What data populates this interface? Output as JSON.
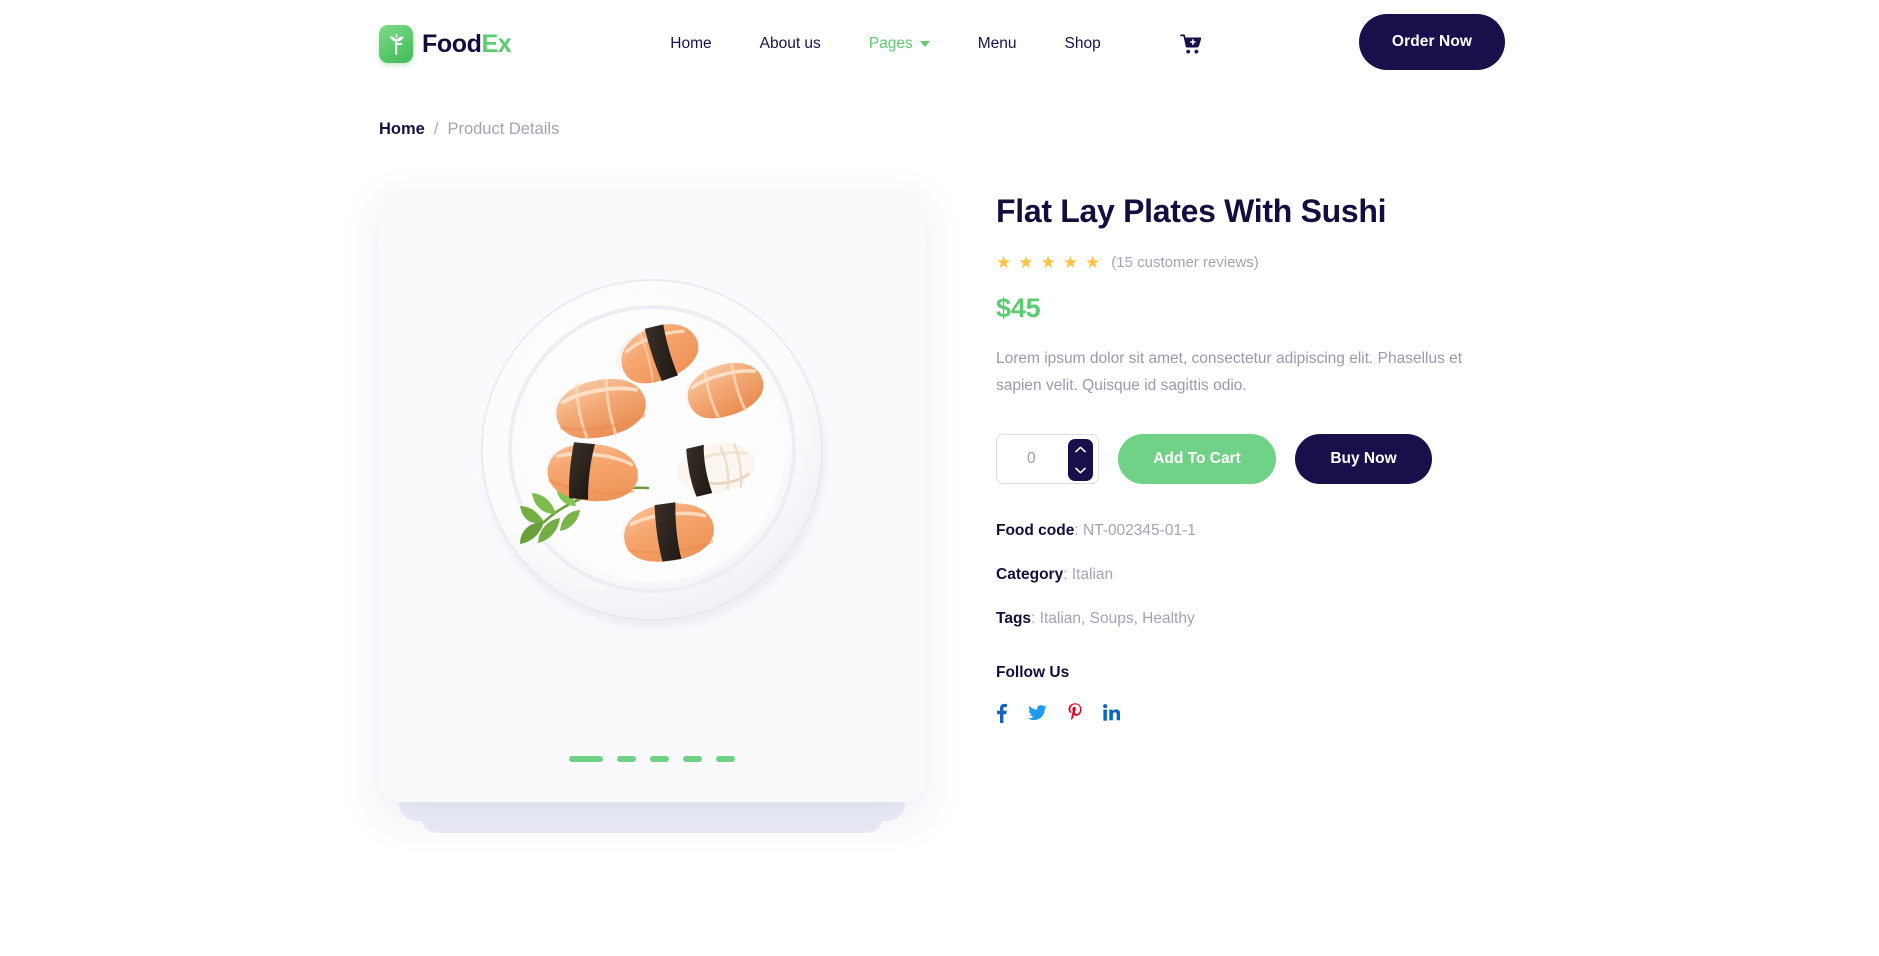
{
  "header": {
    "brand": {
      "name_dark": "Food",
      "name_accent": "Ex",
      "icon": "leaf-sprout-icon"
    },
    "nav": [
      {
        "label": "Home",
        "active": false,
        "caret": false
      },
      {
        "label": "About us",
        "active": false,
        "caret": false
      },
      {
        "label": "Pages",
        "active": true,
        "caret": true
      },
      {
        "label": "Menu",
        "active": false,
        "caret": false
      },
      {
        "label": "Shop",
        "active": false,
        "caret": false
      }
    ],
    "cart_icon": "shopping-cart-add-icon",
    "order_button": "Order Now"
  },
  "breadcrumb": {
    "home": "Home",
    "separator": "/",
    "current": "Product Details"
  },
  "gallery": {
    "alt": "Flat lay white plate with six pieces of salmon sushi and parsley garnish",
    "dots": [
      {
        "active": true
      },
      {
        "active": false
      },
      {
        "active": false
      },
      {
        "active": false
      },
      {
        "active": false
      }
    ]
  },
  "product": {
    "title": "Flat Lay Plates With Sushi",
    "stars": 5,
    "star_glyph": "★",
    "review_count": "(15 customer reviews)",
    "price": "$45",
    "description": "Lorem ipsum dolor sit amet, consectetur adipiscing elit. Phasellus et sapien velit. Quisque id sagittis odio.",
    "quantity_value": "0",
    "quantity_placeholder": "0",
    "add_to_cart_label": "Add To Cart",
    "buy_now_label": "Buy Now",
    "meta": [
      {
        "label": "Food code",
        "value": ": NT-002345-01-1"
      },
      {
        "label": "Category",
        "value": ": Italian"
      },
      {
        "label": "Tags",
        "value": ": Italian, Soups, Healthy"
      }
    ],
    "follow_title": "Follow Us",
    "socials": [
      {
        "name": "facebook-icon",
        "color": "#1764c0"
      },
      {
        "name": "twitter-icon",
        "color": "#1d9bf0"
      },
      {
        "name": "pinterest-icon",
        "color": "#e60023"
      },
      {
        "name": "linkedin-icon",
        "color": "#0a66c2"
      }
    ]
  },
  "colors": {
    "brand_green": "#5ccb72",
    "navy": "#190f4a",
    "star_gold": "#fbc33f",
    "muted_text": "#a3a2b9",
    "card_bg": "#fafafd"
  }
}
